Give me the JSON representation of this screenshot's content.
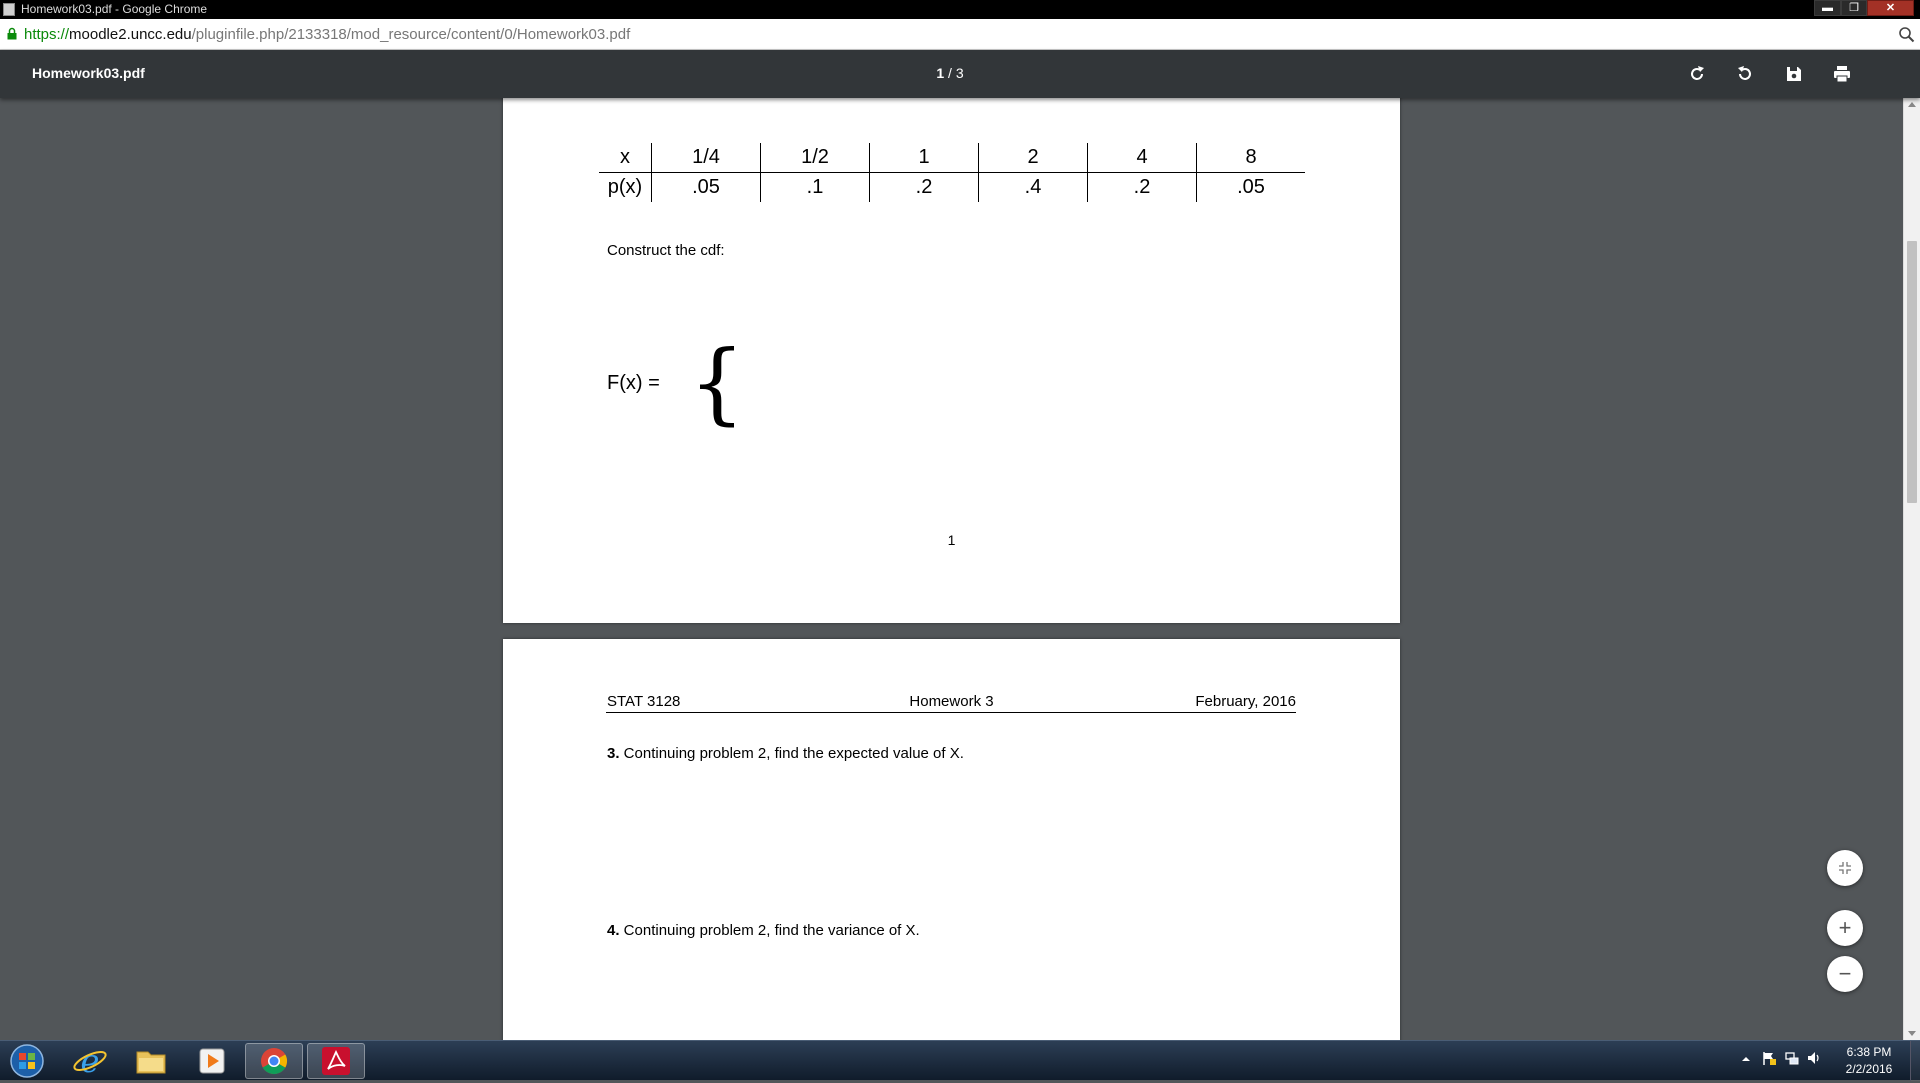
{
  "window": {
    "title": "Homework03.pdf - Google Chrome",
    "minimize": "▬",
    "maximize": "❐",
    "close": "✕"
  },
  "address": {
    "scheme": "https://",
    "host": "moodle2.uncc.edu",
    "path": "/pluginfile.php/2133318/mod_resource/content/0/Homework03.pdf"
  },
  "pdf_toolbar": {
    "filename": "Homework03.pdf",
    "current_page": "1",
    "page_separator": "/",
    "total_pages": "3",
    "buttons": [
      "rotate-clockwise-icon",
      "rotate-counterclockwise-icon",
      "download-icon",
      "print-icon"
    ]
  },
  "page1": {
    "table": {
      "x_label": "x",
      "px_label": "p(x)",
      "x_values": [
        "1/4",
        "1/2",
        "1",
        "2",
        "4",
        "8"
      ],
      "p_values": [
        ".05",
        ".1",
        ".2",
        ".4",
        ".2",
        ".05"
      ]
    },
    "construct_text": "Construct the cdf:",
    "fx_label": "F(x) =",
    "brace": "{",
    "page_number": "1"
  },
  "page2": {
    "header_left": "STAT 3128",
    "header_center": "Homework 3",
    "header_right": "February, 2016",
    "q3_number": "3.",
    "q3_text": " Continuing problem 2, find the expected value of X.",
    "q4_number": "4.",
    "q4_text": " Continuing problem 2, find the variance of X."
  },
  "zoom_controls": {
    "fit_icon": "fit-to-page-icon",
    "zoom_in": "+",
    "zoom_out": "−"
  },
  "taskbar": {
    "apps": [
      "start-orb-icon",
      "internet-explorer-icon",
      "file-explorer-icon",
      "media-player-icon",
      "chrome-icon",
      "acrobat-reader-icon"
    ],
    "tray": [
      "show-hidden-icons-icon",
      "action-center-flag-icon",
      "network-icon",
      "volume-icon"
    ],
    "time": "6:38 PM",
    "date": "2/2/2016",
    "hidden_icons_arrow": "▲"
  },
  "colors": {
    "viewer_bg": "#525659",
    "toolbar_bg": "#323639",
    "https_green": "#0a8a0a",
    "close_red": "#a33126"
  }
}
